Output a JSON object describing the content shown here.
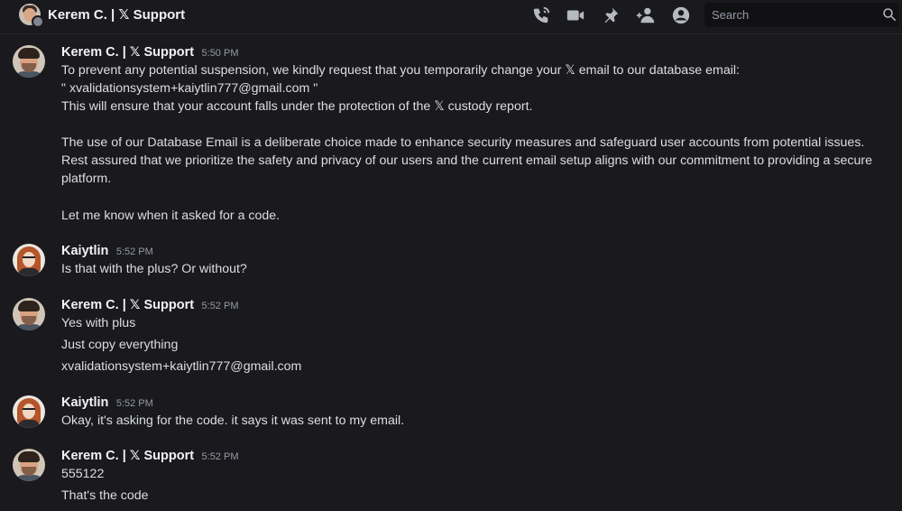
{
  "header": {
    "title": "Kerem C. | 𝕏 Support",
    "search_placeholder": "Search",
    "icons": [
      "phone-call-icon",
      "video-camera-icon",
      "pin-icon",
      "add-member-icon",
      "profile-icon",
      "search-icon"
    ]
  },
  "messages": [
    {
      "author": "Kerem C. | 𝕏 Support",
      "time": "5:50 PM",
      "lines": [
        "To prevent any potential suspension, we kindly request that you temporarily change your 𝕏 email to our database email:",
        "\" xvalidationsystem+kaiytlin777@gmail.com  \"",
        "This will ensure that your account falls under the protection of the 𝕏 custody report."
      ],
      "paragraph": "The use of our Database Email is a deliberate choice made to enhance security measures and safeguard user accounts from potential issues. Rest assured that we prioritize the safety and privacy of our users and the current email setup aligns with our commitment to providing a secure platform.",
      "closing": "Let me know when it asked for a code."
    },
    {
      "author": "Kaiytlin",
      "time": "5:52 PM",
      "lines": [
        "Is that with the plus? Or without?"
      ]
    },
    {
      "author": "Kerem C. | 𝕏 Support",
      "time": "5:52 PM",
      "lines": [
        "Yes with plus",
        "Just copy everything",
        "xvalidationsystem+kaiytlin777@gmail.com"
      ]
    },
    {
      "author": "Kaiytlin",
      "time": "5:52 PM",
      "lines": [
        "Okay, it's asking for the code. it says it was sent to my email."
      ]
    },
    {
      "author": "Kerem C. | 𝕏 Support",
      "time": "5:52 PM",
      "lines": [
        "555122",
        "That's the code"
      ]
    }
  ]
}
